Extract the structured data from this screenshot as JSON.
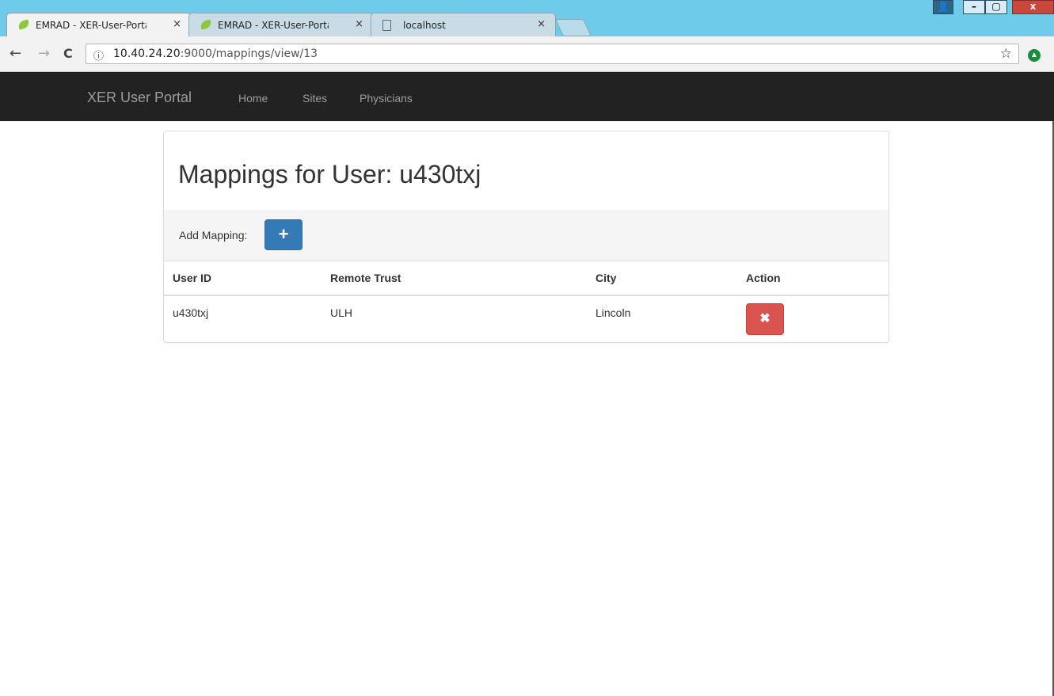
{
  "browser": {
    "tabs": [
      {
        "title": "EMRAD - XER-User-Porta",
        "close": "×",
        "icon": "spring-leaf-icon"
      },
      {
        "title": "EMRAD - XER-User-Porta",
        "close": "×",
        "icon": "spring-leaf-icon"
      },
      {
        "title": "localhost",
        "close": "×",
        "icon": "page-icon"
      }
    ],
    "window_buttons": {
      "user": "👤",
      "minimize": "–",
      "maximize": "▢",
      "close": "x"
    },
    "nav": {
      "back": "←",
      "forward": "→",
      "reload": "C"
    },
    "address": {
      "info_icon": "ⓘ",
      "host": "10.40.24.20",
      "rest": ":9000/mappings/view/13",
      "star": "☆"
    },
    "extension_icon": "▲"
  },
  "navbar": {
    "brand": "XER User Portal",
    "links": [
      "Home",
      "Sites",
      "Physicians"
    ]
  },
  "page": {
    "title": "Mappings for User: u430txj",
    "add_label": "Add Mapping:",
    "add_icon": "+",
    "table": {
      "headers": [
        "User ID",
        "Remote Trust",
        "City",
        "Action"
      ],
      "rows": [
        {
          "user_id": "u430txj",
          "remote_trust": "ULH",
          "city": "Lincoln",
          "action_icon": "✖"
        }
      ]
    }
  },
  "colors": {
    "primary": "#337ab7",
    "danger": "#d9534f",
    "navbar": "#222222",
    "titlebar": "#6ecbe9"
  }
}
